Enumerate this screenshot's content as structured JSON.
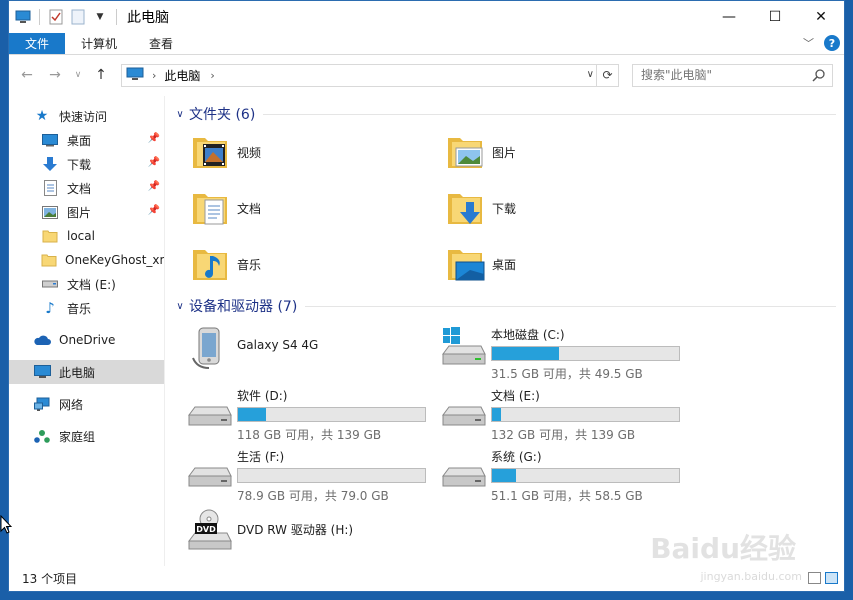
{
  "window": {
    "title": "此电脑"
  },
  "ribbon": {
    "tabs": [
      "文件",
      "计算机",
      "查看"
    ]
  },
  "address": {
    "path": "此电脑"
  },
  "search": {
    "placeholder": "搜索\"此电脑\""
  },
  "sidebar": {
    "quick_access": "快速访问",
    "items": [
      {
        "label": "桌面",
        "icon": "desktop-icon",
        "pinned": true
      },
      {
        "label": "下载",
        "icon": "download-icon",
        "pinned": true
      },
      {
        "label": "文档",
        "icon": "document-icon",
        "pinned": true
      },
      {
        "label": "图片",
        "icon": "picture-icon",
        "pinned": true
      },
      {
        "label": "local",
        "icon": "folder-icon",
        "pinned": false
      },
      {
        "label": "OneKeyGhost_xmc",
        "icon": "folder-icon",
        "pinned": false
      },
      {
        "label": "文档 (E:)",
        "icon": "drive-icon",
        "pinned": false
      },
      {
        "label": "音乐",
        "icon": "music-icon",
        "pinned": false
      }
    ],
    "onedrive": "OneDrive",
    "this_pc": "此电脑",
    "network": "网络",
    "homegroup": "家庭组"
  },
  "main": {
    "folders_header": "文件夹 (6)",
    "folders": [
      {
        "label": "视频",
        "icon": "video-folder-icon"
      },
      {
        "label": "图片",
        "icon": "picture-folder-icon"
      },
      {
        "label": "文档",
        "icon": "document-folder-icon"
      },
      {
        "label": "下载",
        "icon": "download-folder-icon"
      },
      {
        "label": "音乐",
        "icon": "music-folder-icon"
      },
      {
        "label": "桌面",
        "icon": "desktop-folder-icon"
      }
    ],
    "drives_header": "设备和驱动器 (7)",
    "phone": {
      "label": "Galaxy S4 4G"
    },
    "drives": [
      {
        "name": "本地磁盘 (C:)",
        "size": "31.5 GB 可用，共 49.5 GB",
        "used_fraction": 0.36,
        "os": true
      },
      {
        "name": "软件 (D:)",
        "size": "118 GB 可用，共 139 GB",
        "used_fraction": 0.15,
        "os": false
      },
      {
        "name": "文档 (E:)",
        "size": "132 GB 可用，共 139 GB",
        "used_fraction": 0.05,
        "os": false
      },
      {
        "name": "生活 (F:)",
        "size": "78.9 GB 可用，共 79.0 GB",
        "used_fraction": 0.0,
        "os": false
      },
      {
        "name": "系统 (G:)",
        "size": "51.1 GB 可用，共 58.5 GB",
        "used_fraction": 0.13,
        "os": false
      }
    ],
    "dvd": {
      "label": "DVD RW 驱动器 (H:)",
      "badge": "DVD"
    }
  },
  "status": {
    "count": "13 个项目"
  },
  "watermark": {
    "brand": "Baidu经验",
    "url": "jingyan.baidu.com"
  },
  "colors": {
    "accent": "#1979ca",
    "bar_fill": "#26a0da",
    "group_title": "#1e3287",
    "folder_yellow": "#f8d775"
  }
}
